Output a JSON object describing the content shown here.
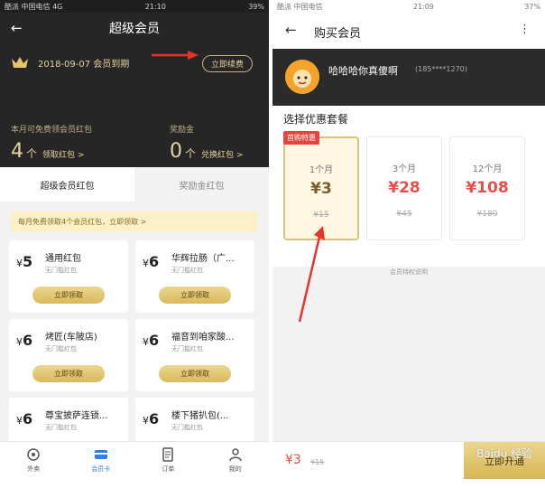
{
  "left": {
    "status": {
      "carrier": "酷派 中国电信 4G",
      "time": "21:10",
      "battery": "39%"
    },
    "nav": {
      "title": "超级会员"
    },
    "expire": {
      "text": "2018-09-07 会员到期",
      "renew_label": "立即续费"
    },
    "stats": {
      "free_caption": "本月可免费领会员红包",
      "free_count": "4",
      "free_unit": "个",
      "free_link": "领取红包 >",
      "bonus_caption": "奖励金",
      "bonus_count": "0",
      "bonus_unit": "个",
      "bonus_link": "兑换红包 >"
    },
    "tabs": [
      {
        "label": "超级会员红包"
      },
      {
        "label": "奖励金红包"
      }
    ],
    "notice": "每月免费领取4个会员红包，立即领取 >",
    "cards": [
      {
        "amount": "5",
        "name": "通用红包",
        "sub": "无门槛红包",
        "btn": "立即领取"
      },
      {
        "amount": "6",
        "name": "华辉拉肠（广...",
        "sub": "无门槛红包",
        "btn": "立即领取"
      },
      {
        "amount": "6",
        "name": "烤匠(车陂店)",
        "sub": "无门槛红包",
        "btn": "立即领取"
      },
      {
        "amount": "6",
        "name": "福音到咱家酸...",
        "sub": "无门槛红包",
        "btn": "立即领取"
      },
      {
        "amount": "6",
        "name": "尊宝披萨连锁...",
        "sub": "无门槛红包"
      },
      {
        "amount": "6",
        "name": "楼下猪扒包(...",
        "sub": "无门槛红包"
      }
    ],
    "bottom_nav": [
      {
        "label": "外卖"
      },
      {
        "label": "会员卡"
      },
      {
        "label": "订单"
      },
      {
        "label": "我的"
      }
    ]
  },
  "right": {
    "status": {
      "carrier": "酷派 中国电信",
      "time": "21:09",
      "battery": "37%"
    },
    "nav": {
      "title": "购买会员"
    },
    "user": {
      "name": "哈哈哈你真傻啊",
      "phone": "(185****1270)"
    },
    "package_title": "选择优惠套餐",
    "first_buy": "首购特惠",
    "packages": [
      {
        "duration": "1个月",
        "price": "¥3",
        "original": "¥15"
      },
      {
        "duration": "3个月",
        "price": "¥28",
        "original": "¥45"
      },
      {
        "duration": "12个月",
        "price": "¥108",
        "original": "¥180"
      }
    ],
    "benefit_link": "会员特权说明",
    "pay_price": "¥3",
    "pay_original": "¥15",
    "open_label": "立即开通",
    "watermark": "Baidu 经验"
  },
  "colors": {
    "gold": "#e6d3a3",
    "dark": "#262626",
    "red": "#e55048",
    "blue": "#2f7df6"
  }
}
